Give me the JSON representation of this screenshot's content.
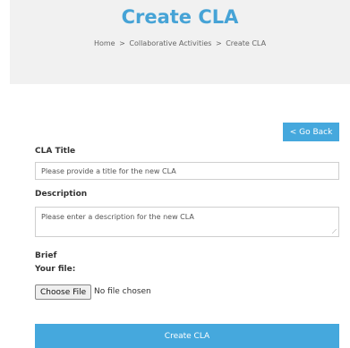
{
  "header": {
    "title": "Create CLA",
    "breadcrumb": [
      "Home",
      "Collaborative Activities",
      "Create CLA"
    ],
    "separator": ">"
  },
  "actions": {
    "go_back": "< Go Back",
    "create": "Create CLA"
  },
  "form": {
    "title_label": "CLA Title",
    "title_placeholder": "Please provide a title for the new CLA",
    "description_label": "Description",
    "description_placeholder": "Please enter a description for the new CLA",
    "brief_label": "Brief",
    "file_label": "Your file:",
    "file_button": "Choose File",
    "file_status": "No file chosen"
  }
}
